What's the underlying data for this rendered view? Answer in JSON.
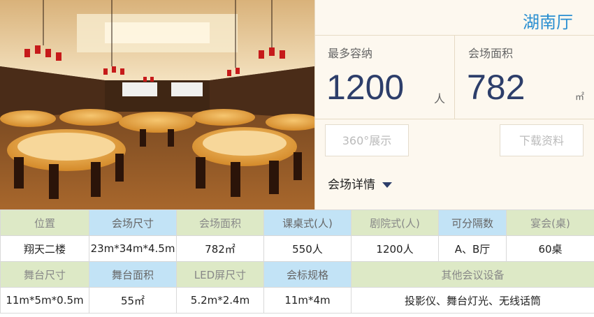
{
  "hall": {
    "name": "湖南厅",
    "capacity_label": "最多容纳",
    "capacity_value": "1200",
    "capacity_unit": "人",
    "area_label": "会场面积",
    "area_value": "782",
    "area_unit": "㎡"
  },
  "buttons": {
    "view360": "360°展示",
    "download": "下载资料"
  },
  "details_label": "会场详情",
  "table": {
    "row1_headers": [
      "位置",
      "会场尺寸",
      "会场面积",
      "课桌式(人)",
      "剧院式(人)",
      "可分隔数",
      "宴会(桌)"
    ],
    "row1_values": [
      "翔天二楼",
      "23m*34m*4.5m",
      "782㎡",
      "550人",
      "1200人",
      "A、B厅",
      "60桌"
    ],
    "row2_headers": [
      "舞台尺寸",
      "舞台面积",
      "LED屏尺寸",
      "会标规格",
      "其他会议设备"
    ],
    "row2_values": [
      "11m*5m*0.5m",
      "55㎡",
      "5.2m*2.4m",
      "11m*4m",
      "投影仪、舞台灯光、无线话筒"
    ]
  },
  "colors": {
    "accent_blue": "#2a8fd1",
    "value_navy": "#2d3e6a",
    "header_green": "#dde9c6",
    "header_blue": "#c2e3f6"
  }
}
